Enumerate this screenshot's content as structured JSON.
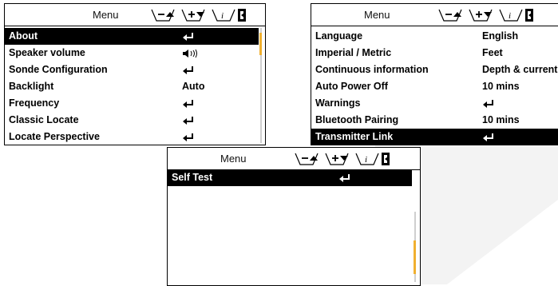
{
  "screens": [
    {
      "title": "Menu",
      "items": [
        {
          "label": "About",
          "value": "enter-icon",
          "selected": true
        },
        {
          "label": "Speaker volume",
          "value": "speaker-icon"
        },
        {
          "label": "Sonde Configuration",
          "value": "enter-icon"
        },
        {
          "label": "Backlight",
          "value": "Auto"
        },
        {
          "label": "Frequency",
          "value": "enter-icon"
        },
        {
          "label": "Classic Locate",
          "value": "enter-icon"
        },
        {
          "label": "Locate Perspective",
          "value": "enter-icon"
        }
      ]
    },
    {
      "title": "Menu",
      "items": [
        {
          "label": "Language",
          "value": "English"
        },
        {
          "label": "Imperial / Metric",
          "value": "Feet"
        },
        {
          "label": "Continuous information",
          "value": "Depth & current"
        },
        {
          "label": "Auto Power Off",
          "value": "10 mins"
        },
        {
          "label": "Warnings",
          "value": "enter-icon"
        },
        {
          "label": "Bluetooth Pairing",
          "value": "10 mins"
        },
        {
          "label": "Transmitter Link",
          "value": "enter-icon",
          "selected": true
        }
      ]
    },
    {
      "title": "Menu",
      "items": [
        {
          "label": "Self Test",
          "value": "enter-icon",
          "selected": true
        }
      ]
    }
  ],
  "header_icons": [
    "minus-up-icon",
    "plus-down-icon",
    "info-icon",
    "exit-icon"
  ],
  "colors": {
    "scroll_thumb": "#f0b030",
    "watermark": "#f2f2f2"
  }
}
